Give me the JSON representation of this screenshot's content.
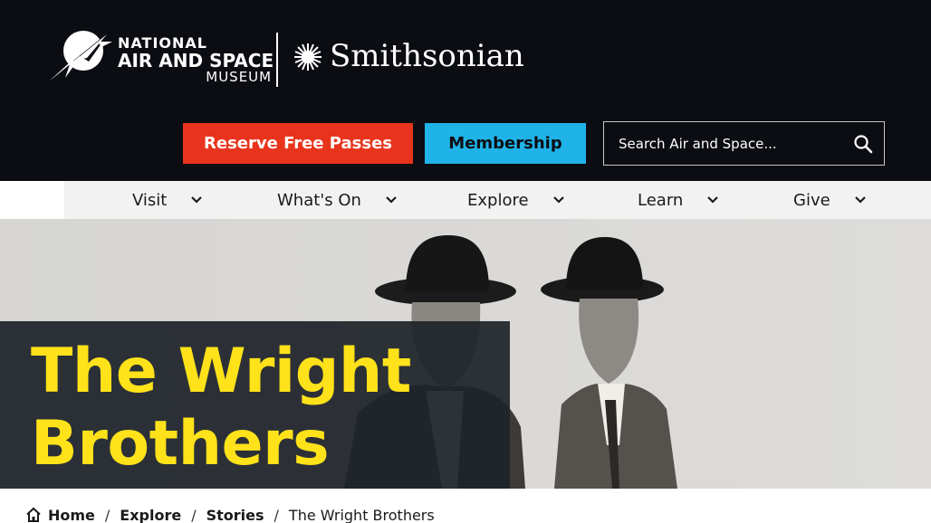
{
  "header": {
    "logo": {
      "museum_line1": "NATIONAL",
      "museum_line2": "AIR AND SPACE",
      "museum_line3": "MUSEUM",
      "institution": "Smithsonian"
    },
    "reserve_label": "Reserve Free Passes",
    "membership_label": "Membership",
    "search": {
      "placeholder": "Search Air and Space...",
      "value": ""
    }
  },
  "nav": {
    "items": [
      {
        "label": "Visit"
      },
      {
        "label": "What's On"
      },
      {
        "label": "Explore"
      },
      {
        "label": "Learn"
      },
      {
        "label": "Give"
      }
    ]
  },
  "hero": {
    "title": "The Wright Brothers"
  },
  "breadcrumb": {
    "home": "Home",
    "items": [
      "Explore",
      "Stories"
    ],
    "separator": "/",
    "current": "The Wright Brothers"
  },
  "colors": {
    "header_bg": "#0b0d12",
    "reserve_bg": "#e8341c",
    "membership_bg": "#1fb3e8",
    "title_color": "#ffe21a",
    "nav_bg": "#f2f2f2"
  },
  "icons": {
    "search": "magnifier-icon",
    "nav_chevron": "chevron-down-icon",
    "home": "house-icon"
  }
}
